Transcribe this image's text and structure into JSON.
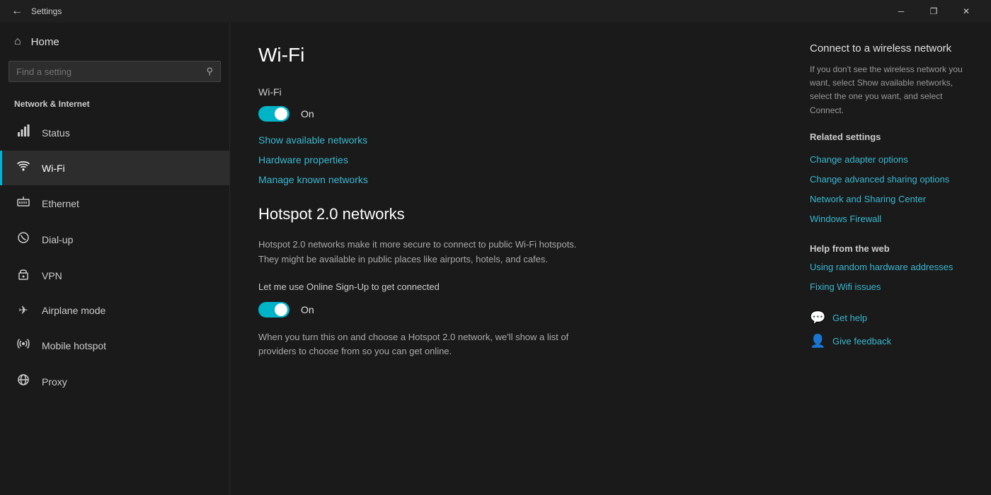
{
  "titlebar": {
    "back_icon": "←",
    "title": "Settings",
    "minimize_icon": "─",
    "maximize_icon": "❐",
    "close_icon": "✕"
  },
  "sidebar": {
    "home_icon": "⌂",
    "home_label": "Home",
    "search_placeholder": "Find a setting",
    "search_icon": "⚲",
    "category": "Network & Internet",
    "items": [
      {
        "id": "status",
        "icon": "🖥",
        "label": "Status"
      },
      {
        "id": "wifi",
        "icon": "📶",
        "label": "Wi-Fi",
        "active": true
      },
      {
        "id": "ethernet",
        "icon": "🔌",
        "label": "Ethernet"
      },
      {
        "id": "dialup",
        "icon": "📞",
        "label": "Dial-up"
      },
      {
        "id": "vpn",
        "icon": "🔒",
        "label": "VPN"
      },
      {
        "id": "airplane",
        "icon": "✈",
        "label": "Airplane mode"
      },
      {
        "id": "hotspot",
        "icon": "📡",
        "label": "Mobile hotspot"
      },
      {
        "id": "proxy",
        "icon": "🌐",
        "label": "Proxy"
      }
    ]
  },
  "main": {
    "page_title": "Wi-Fi",
    "wifi_section_label": "Wi-Fi",
    "wifi_toggle_label": "On",
    "show_networks_link": "Show available networks",
    "hardware_props_link": "Hardware properties",
    "manage_networks_link": "Manage known networks",
    "hotspot_title": "Hotspot 2.0 networks",
    "hotspot_desc": "Hotspot 2.0 networks make it more secure to connect to public Wi-Fi hotspots. They might be available in public places like airports, hotels, and cafes.",
    "hotspot_signup_label": "Let me use Online Sign-Up to get connected",
    "hotspot_signup_toggle_label": "On",
    "hotspot_note": "When you turn this on and choose a Hotspot 2.0 network, we'll show a list of providers to choose from so you can get online."
  },
  "right_panel": {
    "connect_title": "Connect to a wireless network",
    "connect_desc": "If you don't see the wireless network you want, select Show available networks, select the one you want, and select Connect.",
    "related_settings_title": "Related settings",
    "change_adapter": "Change adapter options",
    "change_sharing": "Change advanced sharing options",
    "network_center": "Network and Sharing Center",
    "windows_firewall": "Windows Firewall",
    "help_from_web_title": "Help from the web",
    "help_link1": "Using random hardware addresses",
    "help_link2": "Fixing Wifi issues",
    "get_help_label": "Get help",
    "give_feedback_label": "Give feedback",
    "help_icon": "💬",
    "feedback_icon": "👤"
  }
}
